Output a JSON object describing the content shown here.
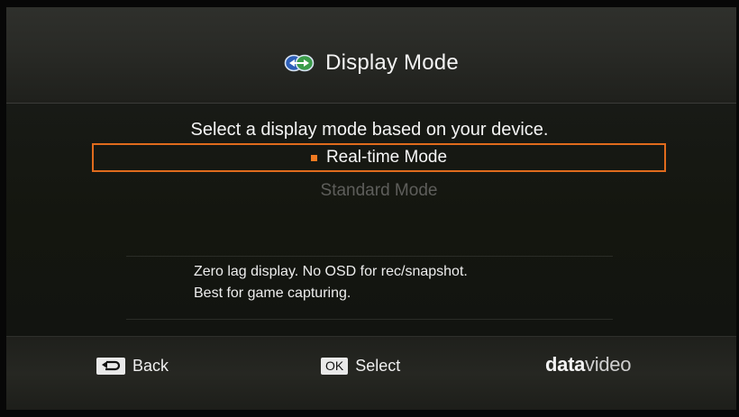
{
  "header": {
    "title": "Display Mode",
    "icon": "display-mode-icon"
  },
  "body": {
    "prompt": "Select a display mode based on your device.",
    "options": [
      {
        "label": "Real-time Mode",
        "selected": true
      },
      {
        "label": "Standard Mode",
        "selected": false
      }
    ],
    "description_lines": [
      "Zero lag display. No OSD for rec/snapshot.",
      "Best for game capturing."
    ]
  },
  "footer": {
    "back": {
      "key_icon": "back-arrow-icon",
      "label": "Back"
    },
    "select": {
      "key_label": "OK",
      "label": "Select"
    },
    "brand": {
      "bold_part": "data",
      "light_part": "video"
    }
  },
  "colors": {
    "accent": "#e06b1d",
    "bullet": "#f07a21",
    "unselected_text": "#5e5e5b"
  }
}
